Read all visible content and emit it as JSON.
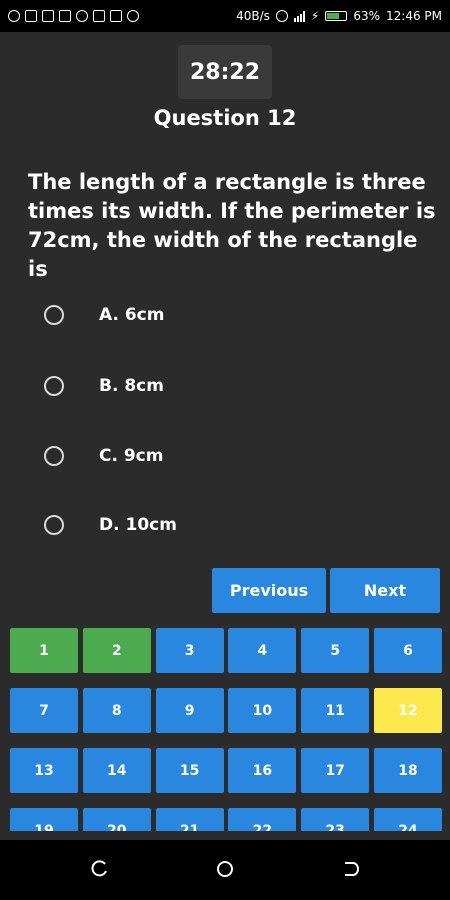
{
  "status_bar": {
    "left_icons": [
      "bluetooth-icon",
      "message-icon",
      "notification-icon",
      "mail-icon",
      "instagram-icon",
      "image-icon",
      "phone-icon",
      "settings-icon"
    ],
    "network_speed": "40B/s",
    "battery_percent": "63%",
    "time": "12:46 PM"
  },
  "quiz": {
    "timer": "28:22",
    "question_title": "Question 12",
    "question_text": "The length of a rectangle is three times its width. If the perimeter is 72cm, the width of the rectangle is",
    "options": [
      {
        "label": "A. 6cm"
      },
      {
        "label": "B. 8cm"
      },
      {
        "label": "C. 9cm"
      },
      {
        "label": "D. 10cm"
      }
    ],
    "previous_label": "Previous",
    "next_label": "Next"
  },
  "question_grid": {
    "items": [
      "1",
      "2",
      "3",
      "4",
      "5",
      "6",
      "7",
      "8",
      "9",
      "10",
      "11",
      "12",
      "13",
      "14",
      "15",
      "16",
      "17",
      "18",
      "19",
      "20",
      "21",
      "22",
      "23",
      "24"
    ],
    "answered": [
      "1",
      "2"
    ],
    "current": "12",
    "colors": {
      "default": "#2a87e0",
      "answered": "#4caa4f",
      "current": "#fde84d"
    }
  },
  "nav_bar": {
    "icons": [
      "recents-icon",
      "home-icon",
      "back-icon"
    ]
  }
}
